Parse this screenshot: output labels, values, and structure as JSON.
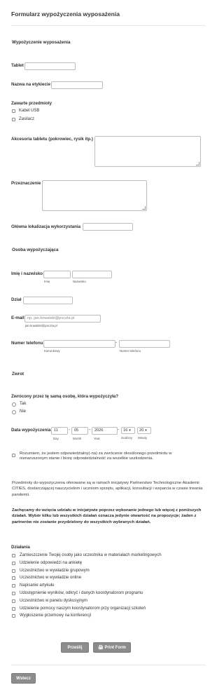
{
  "form": {
    "title": "Formularz wypożyczenia wyposażenia",
    "equipment_section": "Wypożyczenie wyposażenia",
    "tablet_label": "Tablet",
    "sticker_name_label": "Nazwa na etykiecie",
    "included_label": "Zawarte przedmioty",
    "included_items": [
      "Kabel USB",
      "Zasilacz"
    ],
    "accessories_label": "Akcesoria tabletu (pokrowiec, rysik itp.)",
    "purpose_label": "Przeznaczenie",
    "location_label": "Główna lokalizacja wykorzystania",
    "borrower_section": "Osoba wypożyczająca",
    "name_label": "Imię i nazwisko",
    "first_name_sub": "Imię",
    "last_name_sub": "Nazwisko",
    "dept_label": "Dział",
    "email_label": "E-mail",
    "email_placeholder": "np. jan.kowalski@poczta.pl",
    "email_hint": "jan.kowalski@poczta.pl",
    "phone_label": "Numer telefonu",
    "phone_dash": "-",
    "area_code_sub": "Kierunkowy",
    "phone_number_sub": "Numer telefonu",
    "return_section": "Zwrot",
    "returned_question": "Zwrócony przez tę samą osobę, która wypożyczyła?",
    "yes": "Tak",
    "no": "Nie",
    "date_label": "Data wypożyczenia",
    "day": "11",
    "month": "05",
    "year": "2026",
    "sep": "-",
    "hour": "16",
    "minute": "20",
    "day_sub": "Day",
    "month_sub": "Month",
    "year_sub": "Year",
    "hours_sub": "Godziny",
    "minutes_sub": "Minuty",
    "agreement": "Rozumiem, że jestem odpowiedzialny(-na) za zwrócenie określonego przedmiotu w nienaruszonym stanie i biorę odpowiedzialność za wszelkie uszkodzenia.",
    "info_paragraph": "Przedmioty do wypożyczenia oferowane są w ramach inicjatywy Partnerstwo Technologiczne Akademii CITIES, dostarczającej nauczycielom i uczniom sprzętu, aplikacji, konsultacji i wsparcia w czasie trwania pandemii.",
    "bold_paragraph": "Zachęcamy do wzięcia udziału w inicjatywie poprzez wykonanie jednego lub więcej z poniższych działań. Wybór kilku lub wszystkich działań oznacza jedynie otwartość na propozycje; żaden z partnerów nie zostanie przydzielony do wszystkich wybranych działań.",
    "actions_label": "Działania",
    "actions": [
      "Zamieszczenie Twojej osoby jako uczestnika w materiałach marketingowych",
      "Udzielenie odpowiedzi na ankietę",
      "Uczestnictwo w wywiadzie grupowym",
      "Uczestnictwo w wywiadzie online",
      "Napisanie artykułu",
      "Udostępnienie wyników, odkryć i danych koordynatorom programu",
      "Uczestnictwo w panelu dyskusyjnym",
      "Udzielenie pomocy naszym koordynatorom przy organizacji szkoleń",
      "Wygłoszenie przemowy na konferencji"
    ],
    "submit_label": "Prześlij",
    "print_label": "Print Form",
    "back_label": "Wstecz"
  }
}
